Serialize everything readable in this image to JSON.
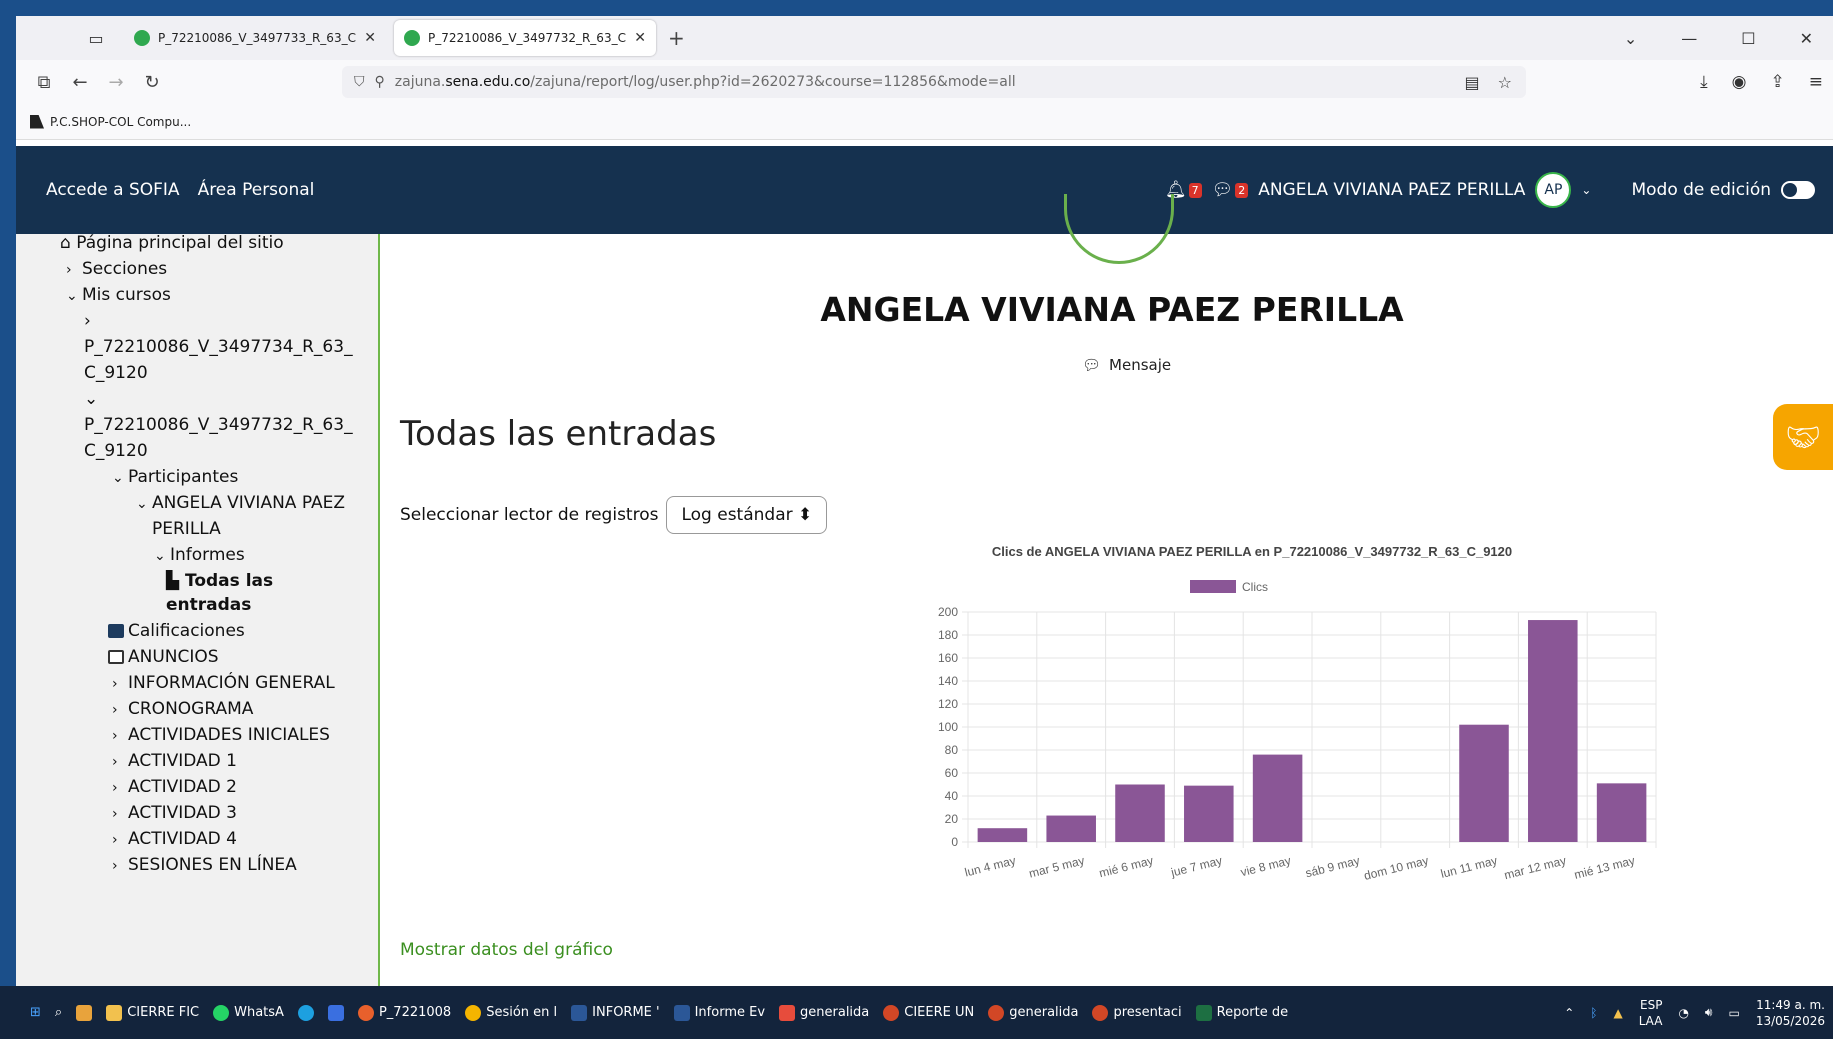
{
  "browser": {
    "tabs": [
      {
        "title": "P_72210086_V_3497733_R_63_C",
        "active": false
      },
      {
        "title": "P_72210086_V_3497732_R_63_C",
        "active": true
      }
    ],
    "url_prefix": "zajuna.",
    "url_domain": "sena.edu.co",
    "url_path": "/zajuna/report/log/user.php?id=2620273&course=112856&mode=all",
    "bookmark": "P.C.SHOP-COL Compu..."
  },
  "sitenav": {
    "link1": "Accede a SOFIA",
    "link2": "Área Personal",
    "notif_count": "7",
    "msg_count": "2",
    "user_name": "ANGELA VIVIANA PAEZ PERILLA",
    "avatar_initials": "AP",
    "edit_mode_label": "Modo de edición"
  },
  "drawer": {
    "home": "Página principal del sitio",
    "sections": "Secciones",
    "my_courses": "Mis cursos",
    "course1_a": "P_72210086_V_3497734_R_63_",
    "course1_b": "C_9120",
    "course2_a": "P_72210086_V_3497732_R_63_",
    "course2_b": "C_9120",
    "participants": "Participantes",
    "user_a": "ANGELA VIVIANA PAEZ",
    "user_b": "PERILLA",
    "reports": "Informes",
    "all_entries_a": "Todas las",
    "all_entries_b": "entradas",
    "grades": "Calificaciones",
    "announcements": "ANUNCIOS",
    "items": [
      "INFORMACIÓN GENERAL",
      "CRONOGRAMA",
      "ACTIVIDADES INICIALES",
      "ACTIVIDAD 1",
      "ACTIVIDAD 2",
      "ACTIVIDAD 3",
      "ACTIVIDAD 4",
      "SESIONES EN LÍNEA"
    ]
  },
  "main": {
    "user_name": "ANGELA VIVIANA PAEZ PERILLA",
    "message_label": "Mensaje",
    "heading": "Todas las entradas",
    "selector_label": "Seleccionar lector de registros",
    "selector_value": "Log estándar",
    "show_data_link": "Mostrar datos del gráfico"
  },
  "chart_data": {
    "type": "bar",
    "title": "Clics de ANGELA VIVIANA PAEZ PERILLA  en P_72210086_V_3497732_R_63_C_9120",
    "categories": [
      "lun 4 may",
      "mar 5 may",
      "mié 6 may",
      "jue 7 may",
      "vie 8 may",
      "sáb 9 may",
      "dom 10 may",
      "lun 11 may",
      "mar 12 may",
      "mié 13 may"
    ],
    "series": [
      {
        "name": "Clics",
        "values": [
          12,
          23,
          50,
          49,
          76,
          0,
          0,
          102,
          193,
          51
        ],
        "color": "#8a5696"
      }
    ],
    "ylim": [
      0,
      200
    ],
    "yticks": [
      0,
      20,
      40,
      60,
      80,
      100,
      120,
      140,
      160,
      180,
      200
    ],
    "legend": "top",
    "grid": true
  },
  "taskbar": {
    "items": [
      "CIERRE FIC",
      "WhatsA",
      "P_7221008",
      "Sesión en l",
      "INFORME '",
      "Informe Ev",
      "generalida",
      "CIEERE UN",
      "generalida",
      "presentaci",
      "Reporte de"
    ],
    "lang1": "ESP",
    "lang2": "LAA",
    "time": "11:49 a. m.",
    "date": "13/05/2026"
  }
}
